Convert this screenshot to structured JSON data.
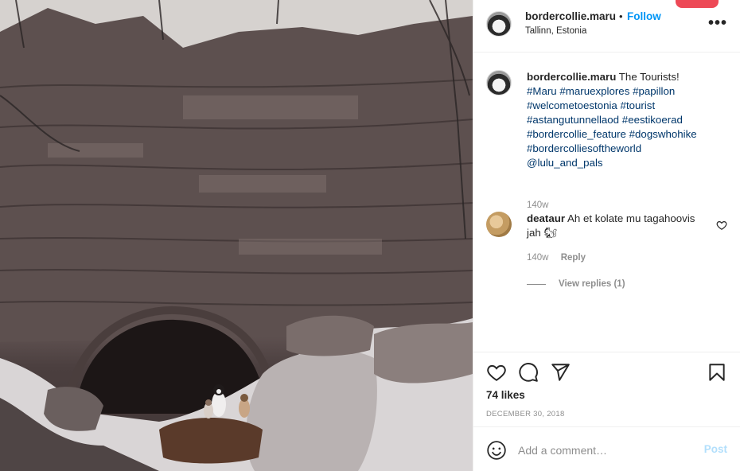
{
  "post": {
    "username": "bordercollie.maru",
    "separator": "•",
    "follow_label": "Follow",
    "location": "Tallinn, Estonia",
    "more_label": "•••"
  },
  "caption": {
    "username": "bordercollie.maru",
    "text": "The Tourists!",
    "tags": [
      "#Maru",
      "#maruexplores",
      "#papillon",
      "#welcometoestonia",
      "#tourist",
      "#astangutunnellaod",
      "#eestikoerad",
      "#bordercollie_feature",
      "#dogswhohike",
      "#bordercolliesoftheworld",
      "@lulu_and_pals"
    ],
    "age": "140w"
  },
  "comment": {
    "username": "deataur",
    "text": "Ah et kolate mu tagahoovis jah 🐿",
    "age": "140w",
    "reply_label": "Reply",
    "view_replies_label": "View replies (1)"
  },
  "actions": {
    "likes": "74 likes",
    "date": "DECEMBER 30, 2018"
  },
  "add_comment": {
    "placeholder": "Add a comment…",
    "post_label": "Post"
  },
  "colors": {
    "follow": "#0095f6",
    "hashtag": "#00376b",
    "post_disabled": "#b2dffc",
    "notification": "#ed4956"
  },
  "icons": [
    "heart-icon",
    "comment-icon",
    "share-icon",
    "bookmark-icon",
    "emoji-icon",
    "more-icon"
  ]
}
